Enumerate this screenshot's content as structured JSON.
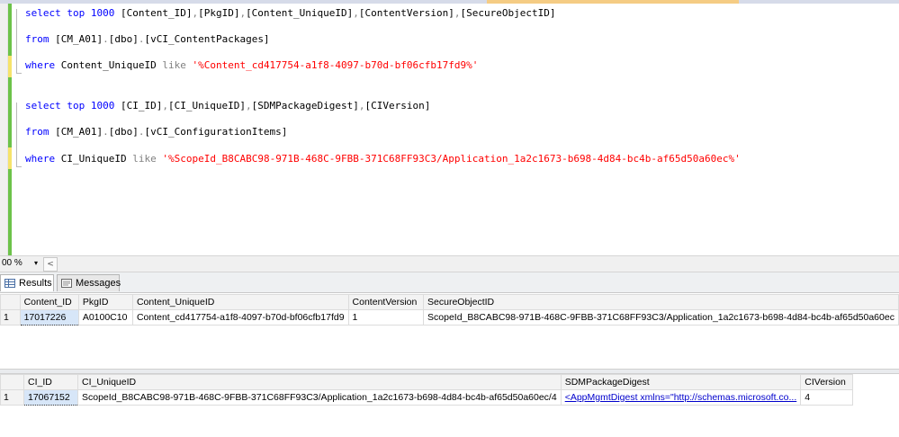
{
  "editor": {
    "lines": [
      {
        "parts": [
          {
            "t": "select top 1000 ",
            "c": "kw"
          },
          {
            "t": "[Content_ID]",
            "c": ""
          },
          {
            "t": ",",
            "c": "gr"
          },
          {
            "t": "[PkgID]",
            "c": ""
          },
          {
            "t": ",",
            "c": "gr"
          },
          {
            "t": "[Content_UniqueID]",
            "c": ""
          },
          {
            "t": ",",
            "c": "gr"
          },
          {
            "t": "[ContentVersion]",
            "c": ""
          },
          {
            "t": ",",
            "c": "gr"
          },
          {
            "t": "[SecureObjectID]",
            "c": ""
          }
        ]
      },
      {
        "parts": [
          {
            "t": "from ",
            "c": "kw"
          },
          {
            "t": "[CM_A01]",
            "c": ""
          },
          {
            "t": ".",
            "c": "gr"
          },
          {
            "t": "[dbo]",
            "c": ""
          },
          {
            "t": ".",
            "c": "gr"
          },
          {
            "t": "[vCI_ContentPackages]",
            "c": ""
          }
        ]
      },
      {
        "parts": [
          {
            "t": "where ",
            "c": "kw"
          },
          {
            "t": "Content_UniqueID ",
            "c": ""
          },
          {
            "t": "like ",
            "c": "gr"
          },
          {
            "t": "'%Content_cd417754-a1f8-4097-b70d-bf06cfb17fd9%'",
            "c": "str"
          }
        ]
      },
      {
        "parts": [
          {
            "t": "select top 1000 ",
            "c": "kw"
          },
          {
            "t": "[CI_ID]",
            "c": ""
          },
          {
            "t": ",",
            "c": "gr"
          },
          {
            "t": "[CI_UniqueID]",
            "c": ""
          },
          {
            "t": ",",
            "c": "gr"
          },
          {
            "t": "[SDMPackageDigest]",
            "c": ""
          },
          {
            "t": ",",
            "c": "gr"
          },
          {
            "t": "[CIVersion]",
            "c": ""
          }
        ]
      },
      {
        "parts": [
          {
            "t": "from ",
            "c": "kw"
          },
          {
            "t": "[CM_A01]",
            "c": ""
          },
          {
            "t": ".",
            "c": "gr"
          },
          {
            "t": "[dbo]",
            "c": ""
          },
          {
            "t": ".",
            "c": "gr"
          },
          {
            "t": "[vCI_ConfigurationItems]",
            "c": ""
          }
        ]
      },
      {
        "parts": [
          {
            "t": "where ",
            "c": "kw"
          },
          {
            "t": "CI_UniqueID ",
            "c": ""
          },
          {
            "t": "like ",
            "c": "gr"
          },
          {
            "t": "'%ScopeId_B8CABC98-971B-468C-9FBB-371C68FF93C3/Application_1a2c1673-b698-4d84-bc4b-af65d50a60ec%'",
            "c": "str"
          }
        ]
      }
    ]
  },
  "zoom": {
    "value": "00 %",
    "dropdown_icon": "chevron-down-icon",
    "scroll_left_icon": "chevron-left-icon"
  },
  "results_tabs": {
    "results": "Results",
    "messages": "Messages"
  },
  "grid1": {
    "columns": [
      "Content_ID",
      "PkgID",
      "Content_UniqueID",
      "ContentVersion",
      "SecureObjectID"
    ],
    "rows": [
      {
        "rownum": "1",
        "cells": [
          "17017226",
          "A0100C10",
          "Content_cd417754-a1f8-4097-b70d-bf06cfb17fd9",
          "1",
          "ScopeId_B8CABC98-971B-468C-9FBB-371C68FF93C3/Application_1a2c1673-b698-4d84-bc4b-af65d50a60ec"
        ]
      }
    ]
  },
  "grid2": {
    "columns": [
      "CI_ID",
      "CI_UniqueID",
      "SDMPackageDigest",
      "CIVersion"
    ],
    "rows": [
      {
        "rownum": "1",
        "cells": [
          "17067152",
          "ScopeId_B8CABC98-971B-468C-9FBB-371C68FF93C3/Application_1a2c1673-b698-4d84-bc4b-af65d50a60ec/4",
          "<AppMgmtDigest xmlns=\"http://schemas.microsoft.co...",
          "4"
        ]
      }
    ]
  }
}
